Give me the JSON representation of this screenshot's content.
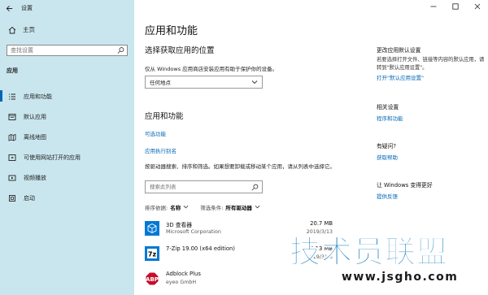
{
  "window": {
    "title": "设置"
  },
  "sidebar": {
    "home": "主页",
    "search_placeholder": "查找设置",
    "section": "应用",
    "items": [
      {
        "label": "应用和功能",
        "active": true
      },
      {
        "label": "默认应用"
      },
      {
        "label": "离线地图"
      },
      {
        "label": "可使用网站打开的应用"
      },
      {
        "label": "视频播放"
      },
      {
        "label": "启动"
      }
    ]
  },
  "main": {
    "title": "应用和功能",
    "install_section": {
      "heading": "选择获取应用的位置",
      "description": "仅从 Windows 应用商店安装应用有助于保护你的设备。",
      "select_value": "任何地点"
    },
    "apps_section": {
      "heading": "应用和功能",
      "link_optional": "可选功能",
      "link_alias": "应用执行别名",
      "description": "按驱动器搜索、排序和筛选。如果想要卸载或移动某个应用，请从列表中选择它。",
      "search_placeholder": "搜索此列表",
      "sort_label": "排序依据:",
      "sort_value": "名称",
      "filter_label": "筛选条件:",
      "filter_value": "所有驱动器"
    },
    "apps": [
      {
        "name": "3D 查看器",
        "publisher": "Microsoft Corporation",
        "size": "20.7 MB",
        "date": "2019/3/13"
      },
      {
        "name": "7-Zip 19.00 (x64 edition)",
        "publisher": "",
        "size": "5.13 MB",
        "date": "2019/3/13"
      },
      {
        "name": "Adblock Plus",
        "publisher": "eyeo GmbH",
        "size": "",
        "date": ""
      }
    ]
  },
  "right_panel": {
    "default_title": "更改应用默认设置",
    "default_text": "若要选择打开文件、链接等内容的默认应用，请转到\"默认应用设置\"。",
    "default_link": "打开\"默认应用设置\"",
    "related_title": "相关设置",
    "related_link": "程序和功能",
    "question_title": "有疑问?",
    "question_link": "获取帮助",
    "improve_title": "让 Windows 变得更好",
    "improve_link": "提供反馈"
  },
  "watermark": {
    "text": "技术员联盟",
    "url": "www.jsgho.com"
  },
  "colors": {
    "sidebar_bg": "#c9e6ee",
    "accent": "#0067b8",
    "watermark": "#1780c0"
  }
}
